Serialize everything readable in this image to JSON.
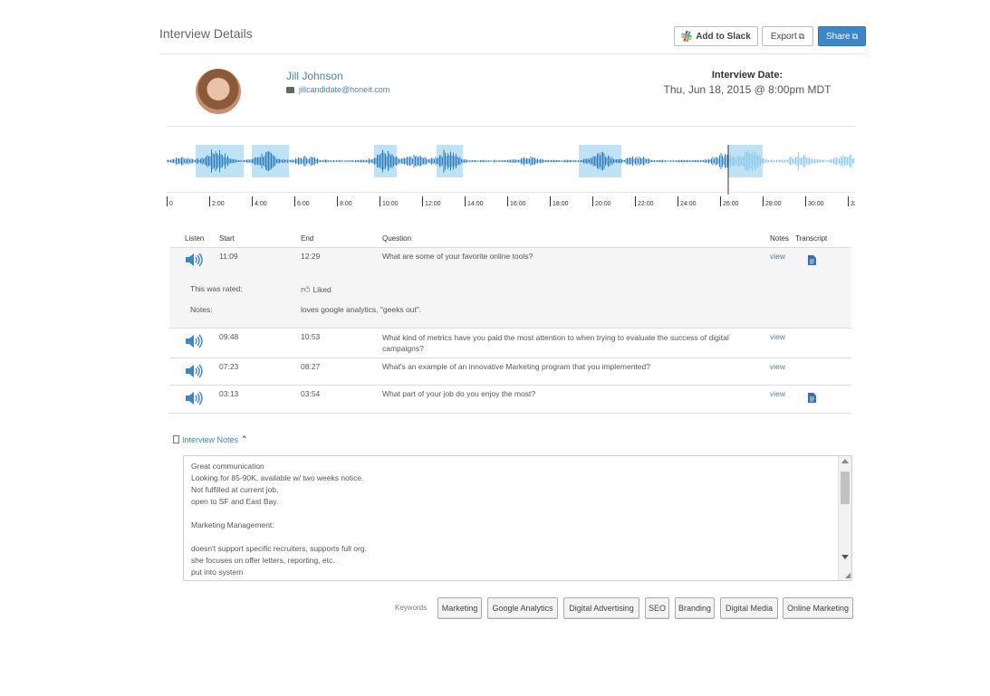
{
  "page": {
    "title": "Interview Details"
  },
  "toolbar": {
    "slack_label": "Add to Slack",
    "export_label": "Export",
    "share_label": "Share"
  },
  "candidate": {
    "name": "Jill Johnson",
    "email": "jillcandidate@honeit.com"
  },
  "interview": {
    "date_label": "Interview Date:",
    "date_value": "Thu, Jun 18, 2015 @ 8:00pm MDT"
  },
  "timeline": {
    "ticks": [
      "0",
      "2:00",
      "4:00",
      "6:00",
      "8:00",
      "10:00",
      "12:00",
      "14:00",
      "16:00",
      "18:00",
      "20:00",
      "22:00",
      "24:00",
      "26:00",
      "28:00",
      "30:00",
      "32"
    ]
  },
  "table": {
    "headers": {
      "listen": "Listen",
      "start": "Start",
      "end": "End",
      "question": "Question",
      "notes": "Notes",
      "transcript": "Transcript"
    },
    "rows": [
      {
        "start": "11:09",
        "end": "12:29",
        "question": "What are some of your favorite online tools?",
        "notes": "view",
        "has_transcript": true
      },
      {
        "start": "09:48",
        "end": "10:53",
        "question": "What kind of metrics have you paid the most attention to when trying to evaluate the success of digital campaigns?",
        "notes": "view",
        "has_transcript": false
      },
      {
        "start": "07:23",
        "end": "08:27",
        "question": "What's an example of an innovative Marketing program that you implemented?",
        "notes": "view",
        "has_transcript": false
      },
      {
        "start": "03:13",
        "end": "03:54",
        "question": "What part of your job do you enjoy the most?",
        "notes": "view",
        "has_transcript": true
      }
    ],
    "expanded": {
      "rated_label": "This was rated:",
      "rated_value": "Liked",
      "notes_label": "Notes:",
      "notes_value": "loves google analytics, \"geeks out\"."
    }
  },
  "notes": {
    "toggle_label": "Interview Notes",
    "text": "Great communication\nLooking for 85-90K, available w/ two weeks notice.\nNot fulfilled at current job,\nopen to SF and East Bay.\n\nMarketing Management:\n\ndoesn't support specific recruiters, supports full org.\nshe focuses on offer letters, reporting, etc.\nput into system\nother follow-up thru scheduling etc."
  },
  "keywords": {
    "label": "Keywords",
    "items": [
      "Marketing",
      "Google Analytics",
      "Digital Advertising",
      "SEO",
      "Branding",
      "Digital Media",
      "Online Marketing"
    ]
  },
  "colors": {
    "accent": "#3b87c8",
    "link": "#4a7fb5",
    "highlight": "#bfe3f5",
    "wave": "#2f7fc0",
    "wave_future": "#8fcbe8"
  }
}
